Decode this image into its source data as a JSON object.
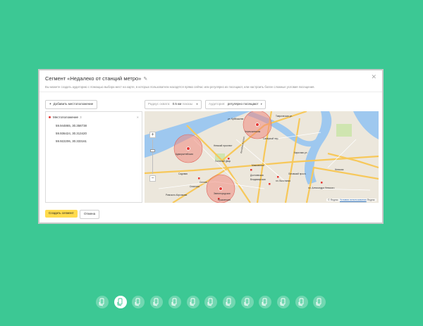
{
  "dialog": {
    "title": "Сегмент «Недалеко от станций метро»",
    "subtitle": "Вы можете создать аудиторию с помощью выбора мест на карте, в которых пользователи находятся прямо сейчас или регулярно их посещают, или настроить более сложные условия посещения.",
    "close_icon": "close-icon",
    "edit_icon": "pencil-icon"
  },
  "toolbar": {
    "add_location_label": "Добавить местоположение",
    "radius_label": "Радиус охвата:",
    "radius_value": "0.5 км",
    "radius_unit": "показы",
    "audience_label": "Аудитория:",
    "audience_value": "регулярно посещают"
  },
  "locations": {
    "header": "Местоположение",
    "count": "3",
    "items": [
      "59.944865, 30.358738",
      "59.936424, 30.313420",
      "59.922206, 30.333161"
    ]
  },
  "map": {
    "labels": {
      "chernyshevskaya": "Чернышевская",
      "admiralteyskaya": "Адмиралтейская",
      "nevsky": "Невский проспект",
      "gostiny": "Гостиный Двор",
      "dostoevskaya": "Достоевская",
      "mayakovskaya": "Маяковская",
      "ligovsky": "Лиговский просп.",
      "sennaya": "Сенная",
      "spasskaya": "Спасская",
      "sadovaya": "Садовая",
      "vladimirskaya": "Владимирская",
      "zvenigorodskaya": "Звенигородская",
      "pushkinskaya": "Пушкинская",
      "ploshchad_vosstaniya": "пл. Восстания",
      "aleksandra_nevskogo": "пл. Александра Невского",
      "sapiorny": "Сапёрный пер.",
      "liteyny": "Литейный просп.",
      "nevskaya": "Невская",
      "tavricheskaya": "Таврическая ул.",
      "kirochnaya": "Кирочная ул.",
      "rimskogo": "Римского-Корсакова",
      "kuibysheva": "ул. Куйбышева"
    },
    "copyright": "© Яндекс",
    "terms": "Условия использования",
    "logo": "Яндекс",
    "zoom_in": "+",
    "zoom_out": "−"
  },
  "footer": {
    "create_label": "Создать сегмент",
    "cancel_label": "Отмена"
  },
  "colors": {
    "background": "#3cc894",
    "primary_button": "#ffdb4d",
    "marker": "#e53935",
    "water": "#9ec8ef",
    "road": "#f7c85a"
  },
  "pagination": {
    "count": 13,
    "active_index": 1
  }
}
